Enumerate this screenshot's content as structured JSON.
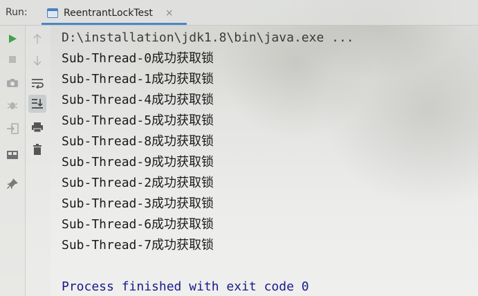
{
  "header": {
    "run_label": "Run:",
    "tab_title": "ReentrantLockTest",
    "tab_close": "×"
  },
  "toolbar_left": [
    {
      "name": "rerun-icon",
      "glyph": "▶"
    },
    {
      "name": "stop-icon",
      "glyph": "■"
    },
    {
      "name": "camera-icon",
      "glyph": "📷"
    },
    {
      "name": "debug-icon",
      "glyph": "✱"
    },
    {
      "name": "exit-icon",
      "glyph": "⇥"
    },
    {
      "name": "layout-icon",
      "glyph": "▭"
    },
    {
      "name": "pin-icon",
      "glyph": "📌"
    }
  ],
  "toolbar_right": [
    {
      "name": "up-arrow-icon",
      "glyph": "↑"
    },
    {
      "name": "down-arrow-icon",
      "glyph": "↓"
    },
    {
      "name": "soft-wrap-icon",
      "glyph": "⮐"
    },
    {
      "name": "scroll-to-end-icon",
      "glyph": "⤓"
    },
    {
      "name": "print-icon",
      "glyph": "🖶"
    },
    {
      "name": "trash-icon",
      "glyph": "🗑"
    }
  ],
  "console": {
    "command": "D:\\installation\\jdk1.8\\bin\\java.exe ...",
    "lines": [
      "Sub-Thread-0成功获取锁",
      "Sub-Thread-1成功获取锁",
      "Sub-Thread-4成功获取锁",
      "Sub-Thread-5成功获取锁",
      "Sub-Thread-8成功获取锁",
      "Sub-Thread-9成功获取锁",
      "Sub-Thread-2成功获取锁",
      "Sub-Thread-3成功获取锁",
      "Sub-Thread-6成功获取锁",
      "Sub-Thread-7成功获取锁"
    ],
    "blank": "",
    "exit_message": "Process finished with exit code 0"
  },
  "colors": {
    "run_green": "#3fa14b",
    "accent_blue": "#4a88c7",
    "exit_text": "#1a1a8a"
  }
}
